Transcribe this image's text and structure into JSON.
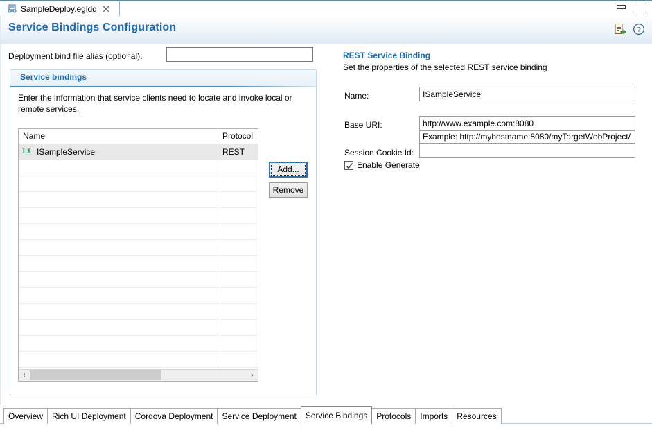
{
  "window": {
    "editor_tab": {
      "label": "SampleDeploy.egldd",
      "icon": "deployment-descriptor-icon",
      "close_icon": "close-icon"
    },
    "controls": {
      "minimize": "minimize-button",
      "maximize": "maximize-button"
    }
  },
  "form_header": {
    "title": "Service Bindings Configuration",
    "tools": [
      {
        "name": "export-source-icon",
        "tooltip": "Source"
      },
      {
        "name": "help-icon",
        "tooltip": "Help"
      }
    ]
  },
  "left_pane": {
    "alias_label": "Deployment bind file alias (optional):",
    "alias_value": "",
    "alias_placeholder": "",
    "section": {
      "title": "Service bindings",
      "description": "Enter the information that service clients need to locate and invoke local or remote services.",
      "table": {
        "columns": [
          "Name",
          "Protocol"
        ],
        "rows": [
          {
            "name": "ISampleService",
            "protocol": "REST",
            "selected": true,
            "icon": "service-binding-icon"
          }
        ],
        "empty_row_count": 15,
        "scrollbar": {
          "left_arrow": "‹",
          "right_arrow": "›"
        }
      },
      "buttons": {
        "add": "Add...",
        "remove": "Remove"
      }
    }
  },
  "right_pane": {
    "title": "REST Service Binding",
    "description": "Set the properties of the selected REST service binding",
    "fields": [
      {
        "label": "Name:",
        "value": "ISampleService"
      },
      {
        "label": "Base URI:",
        "value": "http://www.example.com:8080"
      },
      {
        "label": "Session Cookie Id:",
        "value": ""
      }
    ],
    "base_uri_hint": "Example: http://myhostname:8080/myTargetWebProject/",
    "checkbox": {
      "label": "Enable Generate",
      "checked": true
    }
  },
  "page_tabs": {
    "items": [
      {
        "label": "Overview",
        "active": false
      },
      {
        "label": "Rich UI Deployment",
        "active": false
      },
      {
        "label": "Cordova Deployment",
        "active": false
      },
      {
        "label": "Service Deployment",
        "active": false
      },
      {
        "label": "Service Bindings",
        "active": true
      },
      {
        "label": "Protocols",
        "active": false
      },
      {
        "label": "Imports",
        "active": false
      },
      {
        "label": "Resources",
        "active": false
      }
    ]
  },
  "colors": {
    "accent_blue": "#1a6ab5",
    "focus_blue": "#2e74b5",
    "tab_border": "#9ab4c4",
    "selection_gray": "#e8e8e8"
  }
}
